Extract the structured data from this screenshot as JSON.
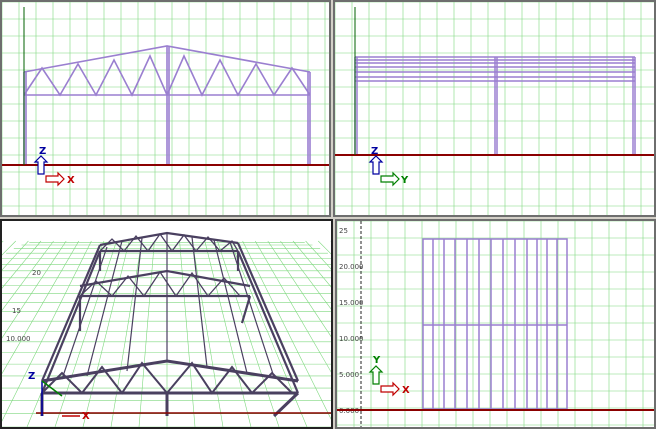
{
  "colors": {
    "grid_minor": "#7fd87f",
    "grid_major": "#55c055",
    "structure": "#9a7fd0",
    "structure_dark": "#4a4060",
    "ground_axis": "#8b0000",
    "z_axis": "#0000a0",
    "axis_arrow_fill": "#ffffff",
    "x_axis_arrow": "#c00000",
    "y_axis_arrow": "#008000"
  },
  "viewports": {
    "front": {
      "h_axis_label": "X",
      "v_axis_label": "Z"
    },
    "side": {
      "h_axis_label": "Y",
      "v_axis_label": "Z"
    },
    "perspective": {
      "h_axis_label": "X",
      "v_axis_label": "Z",
      "tick_labels": [
        "10.000",
        "15",
        "20"
      ]
    },
    "plan": {
      "h_axis_label": "X",
      "v_axis_label": "Y",
      "tick_labels": [
        "25",
        "20.000",
        "15.000",
        "10.000",
        "5.000",
        "0.000"
      ]
    }
  }
}
